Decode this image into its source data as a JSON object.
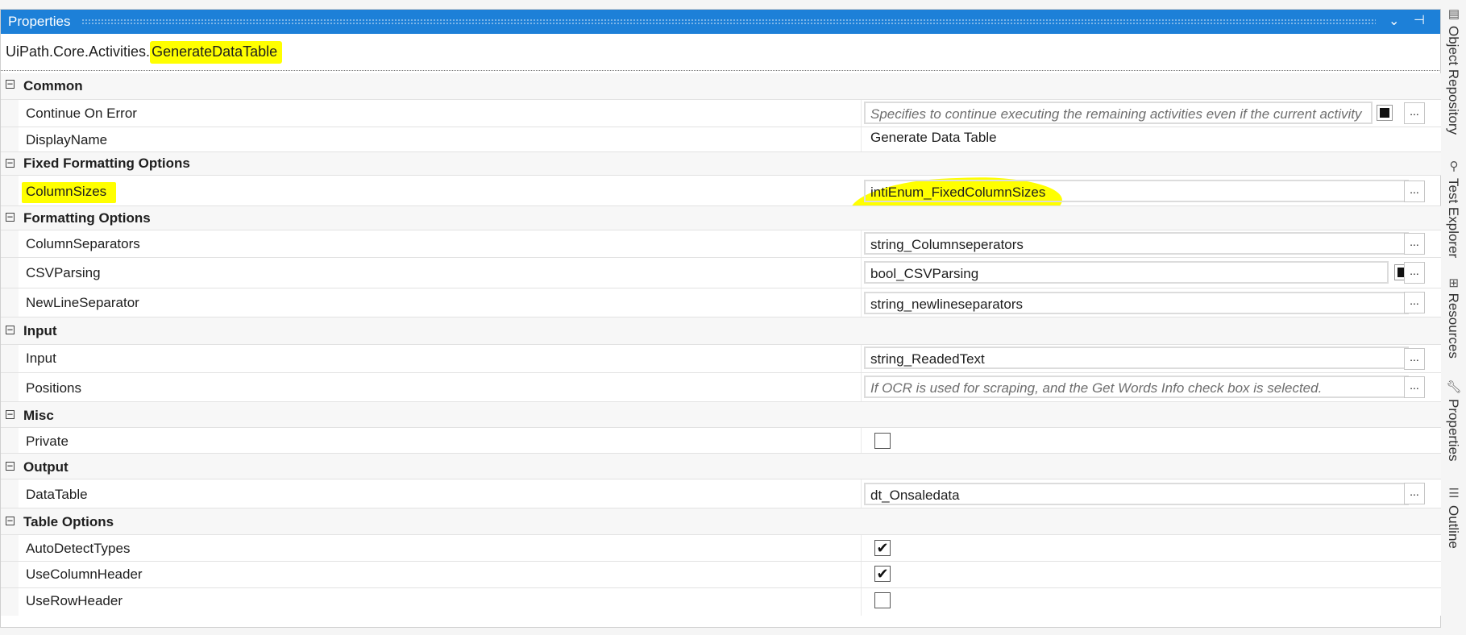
{
  "panel": {
    "title": "Properties",
    "dropdown_glyph": "⌄",
    "pin_glyph": "⊣"
  },
  "typeline": {
    "prefix": "UiPath.Core.Activities.",
    "name": "GenerateDataTable"
  },
  "categories": {
    "common": {
      "label": "Common",
      "continue_on_error": {
        "name": "Continue On Error",
        "placeholder": "Specifies to continue executing the remaining activities even if the current activity"
      },
      "display_name": {
        "name": "DisplayName",
        "value": "Generate Data Table"
      }
    },
    "fixed": {
      "label": "Fixed Formatting Options",
      "column_sizes": {
        "name": "ColumnSizes",
        "value": "intiEnum_FixedColumnSizes"
      }
    },
    "formatting": {
      "label": "Formatting Options",
      "column_separators": {
        "name": "ColumnSeparators",
        "value": "string_Columnseperators"
      },
      "csv_parsing": {
        "name": "CSVParsing",
        "value": "bool_CSVParsing"
      },
      "new_line_separator": {
        "name": "NewLineSeparator",
        "value": "string_newlineseparators"
      }
    },
    "input": {
      "label": "Input",
      "input": {
        "name": "Input",
        "value": "string_ReadedText"
      },
      "positions": {
        "name": "Positions",
        "placeholder": "If OCR is used for scraping, and the Get Words Info check box is selected."
      }
    },
    "misc": {
      "label": "Misc",
      "private": {
        "name": "Private",
        "checked": false
      }
    },
    "output": {
      "label": "Output",
      "data_table": {
        "name": "DataTable",
        "value": "dt_Onsaledata"
      }
    },
    "table_options": {
      "label": "Table Options",
      "auto_detect_types": {
        "name": "AutoDetectTypes",
        "checked": true
      },
      "use_column_header": {
        "name": "UseColumnHeader",
        "checked": true
      },
      "use_row_header": {
        "name": "UseRowHeader",
        "checked": false
      }
    }
  },
  "ui": {
    "toggle_glyph": "−",
    "ellipsis": "...",
    "check_glyph": "✔"
  },
  "sidebar": {
    "tabs": [
      {
        "label": "Object Repository",
        "icon": "object-repository-icon"
      },
      {
        "label": "Test Explorer",
        "icon": "test-explorer-icon"
      },
      {
        "label": "Resources",
        "icon": "resources-icon"
      },
      {
        "label": "Properties",
        "icon": "wrench-icon"
      },
      {
        "label": "Outline",
        "icon": "outline-icon"
      }
    ]
  },
  "colors": {
    "titlebar": "#1d80d8",
    "highlight": "#ffff00"
  }
}
